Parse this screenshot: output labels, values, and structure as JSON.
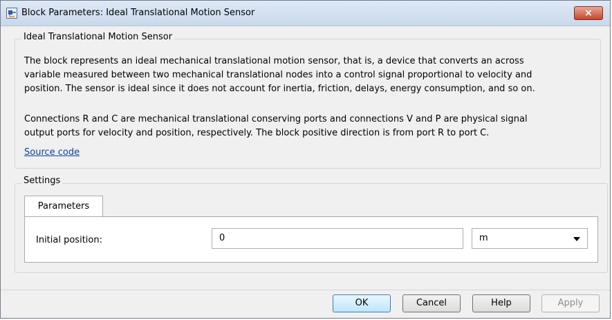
{
  "window": {
    "title": "Block Parameters: Ideal Translational Motion Sensor",
    "close_label": "×"
  },
  "description_group": {
    "legend": "Ideal Translational Motion Sensor",
    "paragraph1_lines": [
      "The block represents an ideal mechanical translational motion sensor, that is, a device that converts an across",
      "variable measured between two mechanical translational nodes into a control signal proportional to velocity and",
      "position. The sensor is ideal since it does not account for inertia, friction, delays, energy consumption, and so on."
    ],
    "paragraph2_lines": [
      "Connections R and C are mechanical translational conserving ports and connections V and P are physical signal",
      "output ports for velocity and position, respectively. The block positive direction is from port R to port C."
    ],
    "source_link": "Source code"
  },
  "settings": {
    "legend": "Settings",
    "tabs": [
      {
        "label": "Parameters"
      }
    ],
    "parameters": {
      "initial_position_label": "Initial position:",
      "initial_position_value": "0",
      "unit_value": "m"
    }
  },
  "buttons": {
    "ok": "OK",
    "cancel": "Cancel",
    "help": "Help",
    "apply": "Apply"
  },
  "colors": {
    "link": "#0b3fa6",
    "close_button": "#c7432b",
    "dialog_background": "#f0f0f0"
  }
}
